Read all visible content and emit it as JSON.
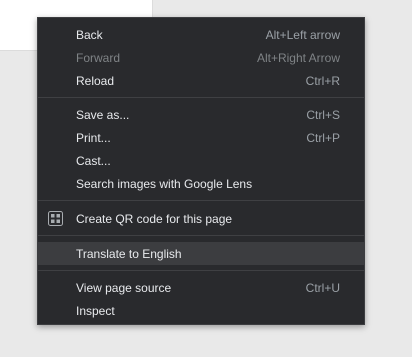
{
  "menu": {
    "items": [
      {
        "label": "Back",
        "shortcut": "Alt+Left arrow"
      },
      {
        "label": "Forward",
        "shortcut": "Alt+Right Arrow"
      },
      {
        "label": "Reload",
        "shortcut": "Ctrl+R"
      },
      {
        "label": "Save as...",
        "shortcut": "Ctrl+S"
      },
      {
        "label": "Print...",
        "shortcut": "Ctrl+P"
      },
      {
        "label": "Cast...",
        "shortcut": ""
      },
      {
        "label": "Search images with Google Lens",
        "shortcut": ""
      },
      {
        "label": "Create QR code for this page",
        "shortcut": "",
        "icon": "qr-code-icon"
      },
      {
        "label": "Translate to English",
        "shortcut": ""
      },
      {
        "label": "View page source",
        "shortcut": "Ctrl+U"
      },
      {
        "label": "Inspect",
        "shortcut": ""
      }
    ]
  },
  "colors": {
    "menu_background": "#292a2d",
    "hover_background": "#3c3d40",
    "text": "#e8eaed",
    "disabled_text": "#7f8386",
    "shortcut_text": "#9aa0a6"
  }
}
